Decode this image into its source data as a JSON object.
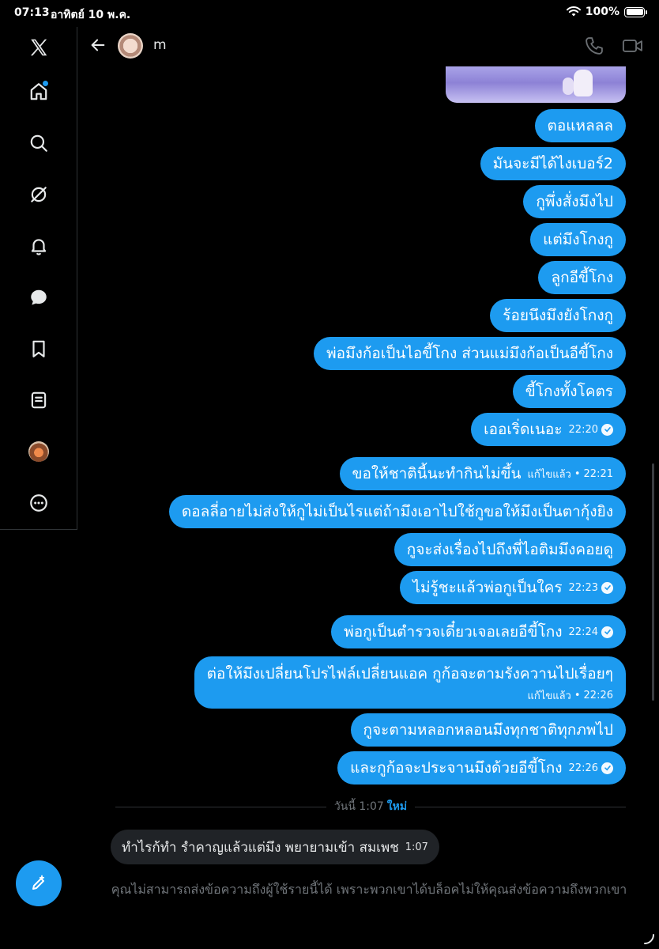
{
  "status": {
    "time": "07:13",
    "date": "อาทิตย์ 10 พ.ค.",
    "battery": "100%"
  },
  "sidebar": {
    "items": [
      {
        "name": "x-logo",
        "icon": "x-logo-icon"
      },
      {
        "name": "home",
        "icon": "home-icon",
        "has_notification_dot": true
      },
      {
        "name": "search",
        "icon": "search-icon"
      },
      {
        "name": "grok",
        "icon": "grok-icon"
      },
      {
        "name": "notifications",
        "icon": "bell-icon"
      },
      {
        "name": "messages",
        "icon": "message-icon"
      },
      {
        "name": "bookmarks",
        "icon": "bookmark-icon"
      },
      {
        "name": "lists",
        "icon": "list-icon"
      },
      {
        "name": "profile",
        "icon": "avatar"
      },
      {
        "name": "more",
        "icon": "more-icon"
      }
    ],
    "compose_icon": "compose-icon"
  },
  "header": {
    "contact_name": "m"
  },
  "messages": [
    {
      "text": "ตอแหลลล"
    },
    {
      "text": "มันจะมีได้ไงเบอร์2"
    },
    {
      "text": "กูพึ่งสั่งมึงไป"
    },
    {
      "text": "แต่มึงโกงกู"
    },
    {
      "text": "ลูกอีขี้โกง"
    },
    {
      "text": "ร้อยนึงมึงยังโกงกู"
    },
    {
      "text": "พ่อมึงก้อเป็นไอขี้โกง ส่วนแม่มึงก้อเป็นอีขี้โกง"
    },
    {
      "text": "ขี้โกงทั้งโคตร"
    },
    {
      "text": "เออเริ่ดเนอะ",
      "time": "22:20",
      "seen": true
    },
    {
      "text": "ขอให้ชาตินี้นะทำกินไม่ขึ้น",
      "edited": "แก้ไขแล้ว",
      "time": "22:21"
    },
    {
      "text": "ดอลลี่อายไม่ส่งให้กูไม่เป็นไรแต่ถ้ามึงเอาไปใช้กูขอให้มึงเป็นตากุ้งยิง"
    },
    {
      "text": "กูจะส่งเรื่องไปถึงพี่ไอติมมึงคอยดู"
    },
    {
      "text": "ไม่รู้ชะแล้วพ่อกูเป็นใคร",
      "time": "22:23",
      "seen": true
    },
    {
      "text": "พ่อกูเป็นตำรวจเดี๋ยวเจอเลยอีขี้โกง",
      "time": "22:24",
      "seen": true
    },
    {
      "text": "ต่อให้มึงเปลี่ยนโปรไฟล์เปลี่ยนแอค กูก้อจะตามรังควานไปเรื่อยๆ",
      "edited": "แก้ไขแล้ว",
      "time": "22:26"
    },
    {
      "text": "กูจะตามหลอกหลอนมึงทุกชาติทุกภพไป"
    },
    {
      "text": "และกูก้อจะประจานมึงด้วยอีขี้โกง",
      "time": "22:26",
      "seen": true
    }
  ],
  "divider": {
    "label": "วันนี้ 1:07",
    "new_label": "ใหม่"
  },
  "received": {
    "text": "ทำไรก้ทำ รำคาญแล้วแต่มึง พยายามเข้า สมเพช",
    "time": "1:07"
  },
  "blocked_note": "คุณไม่สามารถส่งข้อความถึงผู้ใช้รายนี้ได้ เพราะพวกเขาได้บล็อคไม่ให้คุณส่งข้อความถึงพวกเขา",
  "colors": {
    "accent": "#1d9bf0",
    "background": "#000000",
    "received_bubble": "#202327",
    "muted_text": "#71767b"
  }
}
